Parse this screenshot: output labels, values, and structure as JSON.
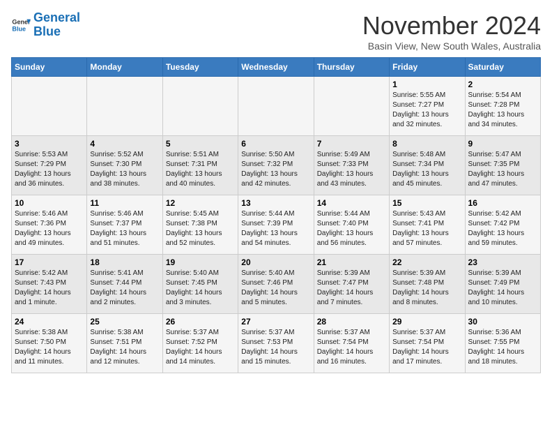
{
  "header": {
    "logo_line1": "General",
    "logo_line2": "Blue",
    "month": "November 2024",
    "location": "Basin View, New South Wales, Australia"
  },
  "days_of_week": [
    "Sunday",
    "Monday",
    "Tuesday",
    "Wednesday",
    "Thursday",
    "Friday",
    "Saturday"
  ],
  "weeks": [
    [
      {
        "day": "",
        "info": ""
      },
      {
        "day": "",
        "info": ""
      },
      {
        "day": "",
        "info": ""
      },
      {
        "day": "",
        "info": ""
      },
      {
        "day": "",
        "info": ""
      },
      {
        "day": "1",
        "info": "Sunrise: 5:55 AM\nSunset: 7:27 PM\nDaylight: 13 hours\nand 32 minutes."
      },
      {
        "day": "2",
        "info": "Sunrise: 5:54 AM\nSunset: 7:28 PM\nDaylight: 13 hours\nand 34 minutes."
      }
    ],
    [
      {
        "day": "3",
        "info": "Sunrise: 5:53 AM\nSunset: 7:29 PM\nDaylight: 13 hours\nand 36 minutes."
      },
      {
        "day": "4",
        "info": "Sunrise: 5:52 AM\nSunset: 7:30 PM\nDaylight: 13 hours\nand 38 minutes."
      },
      {
        "day": "5",
        "info": "Sunrise: 5:51 AM\nSunset: 7:31 PM\nDaylight: 13 hours\nand 40 minutes."
      },
      {
        "day": "6",
        "info": "Sunrise: 5:50 AM\nSunset: 7:32 PM\nDaylight: 13 hours\nand 42 minutes."
      },
      {
        "day": "7",
        "info": "Sunrise: 5:49 AM\nSunset: 7:33 PM\nDaylight: 13 hours\nand 43 minutes."
      },
      {
        "day": "8",
        "info": "Sunrise: 5:48 AM\nSunset: 7:34 PM\nDaylight: 13 hours\nand 45 minutes."
      },
      {
        "day": "9",
        "info": "Sunrise: 5:47 AM\nSunset: 7:35 PM\nDaylight: 13 hours\nand 47 minutes."
      }
    ],
    [
      {
        "day": "10",
        "info": "Sunrise: 5:46 AM\nSunset: 7:36 PM\nDaylight: 13 hours\nand 49 minutes."
      },
      {
        "day": "11",
        "info": "Sunrise: 5:46 AM\nSunset: 7:37 PM\nDaylight: 13 hours\nand 51 minutes."
      },
      {
        "day": "12",
        "info": "Sunrise: 5:45 AM\nSunset: 7:38 PM\nDaylight: 13 hours\nand 52 minutes."
      },
      {
        "day": "13",
        "info": "Sunrise: 5:44 AM\nSunset: 7:39 PM\nDaylight: 13 hours\nand 54 minutes."
      },
      {
        "day": "14",
        "info": "Sunrise: 5:44 AM\nSunset: 7:40 PM\nDaylight: 13 hours\nand 56 minutes."
      },
      {
        "day": "15",
        "info": "Sunrise: 5:43 AM\nSunset: 7:41 PM\nDaylight: 13 hours\nand 57 minutes."
      },
      {
        "day": "16",
        "info": "Sunrise: 5:42 AM\nSunset: 7:42 PM\nDaylight: 13 hours\nand 59 minutes."
      }
    ],
    [
      {
        "day": "17",
        "info": "Sunrise: 5:42 AM\nSunset: 7:43 PM\nDaylight: 14 hours\nand 1 minute."
      },
      {
        "day": "18",
        "info": "Sunrise: 5:41 AM\nSunset: 7:44 PM\nDaylight: 14 hours\nand 2 minutes."
      },
      {
        "day": "19",
        "info": "Sunrise: 5:40 AM\nSunset: 7:45 PM\nDaylight: 14 hours\nand 3 minutes."
      },
      {
        "day": "20",
        "info": "Sunrise: 5:40 AM\nSunset: 7:46 PM\nDaylight: 14 hours\nand 5 minutes."
      },
      {
        "day": "21",
        "info": "Sunrise: 5:39 AM\nSunset: 7:47 PM\nDaylight: 14 hours\nand 7 minutes."
      },
      {
        "day": "22",
        "info": "Sunrise: 5:39 AM\nSunset: 7:48 PM\nDaylight: 14 hours\nand 8 minutes."
      },
      {
        "day": "23",
        "info": "Sunrise: 5:39 AM\nSunset: 7:49 PM\nDaylight: 14 hours\nand 10 minutes."
      }
    ],
    [
      {
        "day": "24",
        "info": "Sunrise: 5:38 AM\nSunset: 7:50 PM\nDaylight: 14 hours\nand 11 minutes."
      },
      {
        "day": "25",
        "info": "Sunrise: 5:38 AM\nSunset: 7:51 PM\nDaylight: 14 hours\nand 12 minutes."
      },
      {
        "day": "26",
        "info": "Sunrise: 5:37 AM\nSunset: 7:52 PM\nDaylight: 14 hours\nand 14 minutes."
      },
      {
        "day": "27",
        "info": "Sunrise: 5:37 AM\nSunset: 7:53 PM\nDaylight: 14 hours\nand 15 minutes."
      },
      {
        "day": "28",
        "info": "Sunrise: 5:37 AM\nSunset: 7:54 PM\nDaylight: 14 hours\nand 16 minutes."
      },
      {
        "day": "29",
        "info": "Sunrise: 5:37 AM\nSunset: 7:54 PM\nDaylight: 14 hours\nand 17 minutes."
      },
      {
        "day": "30",
        "info": "Sunrise: 5:36 AM\nSunset: 7:55 PM\nDaylight: 14 hours\nand 18 minutes."
      }
    ]
  ]
}
